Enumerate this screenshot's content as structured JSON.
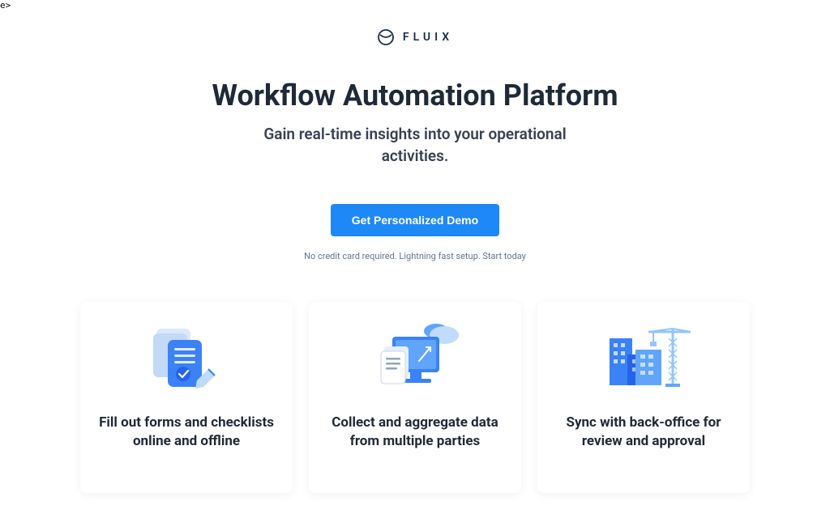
{
  "stray": "e>",
  "brand": {
    "name": "FLUIX"
  },
  "hero": {
    "title": "Workflow Automation Platform",
    "subtitle": "Gain real-time insights into your operational activities."
  },
  "cta": {
    "button": "Get Personalized Demo",
    "note": "No credit card required. Lightning fast setup. Start today"
  },
  "cards": [
    {
      "title": "Fill out forms and checklists online and offline"
    },
    {
      "title": "Collect and aggregate data from multiple parties"
    },
    {
      "title": "Sync with back-office for review and approval"
    }
  ]
}
